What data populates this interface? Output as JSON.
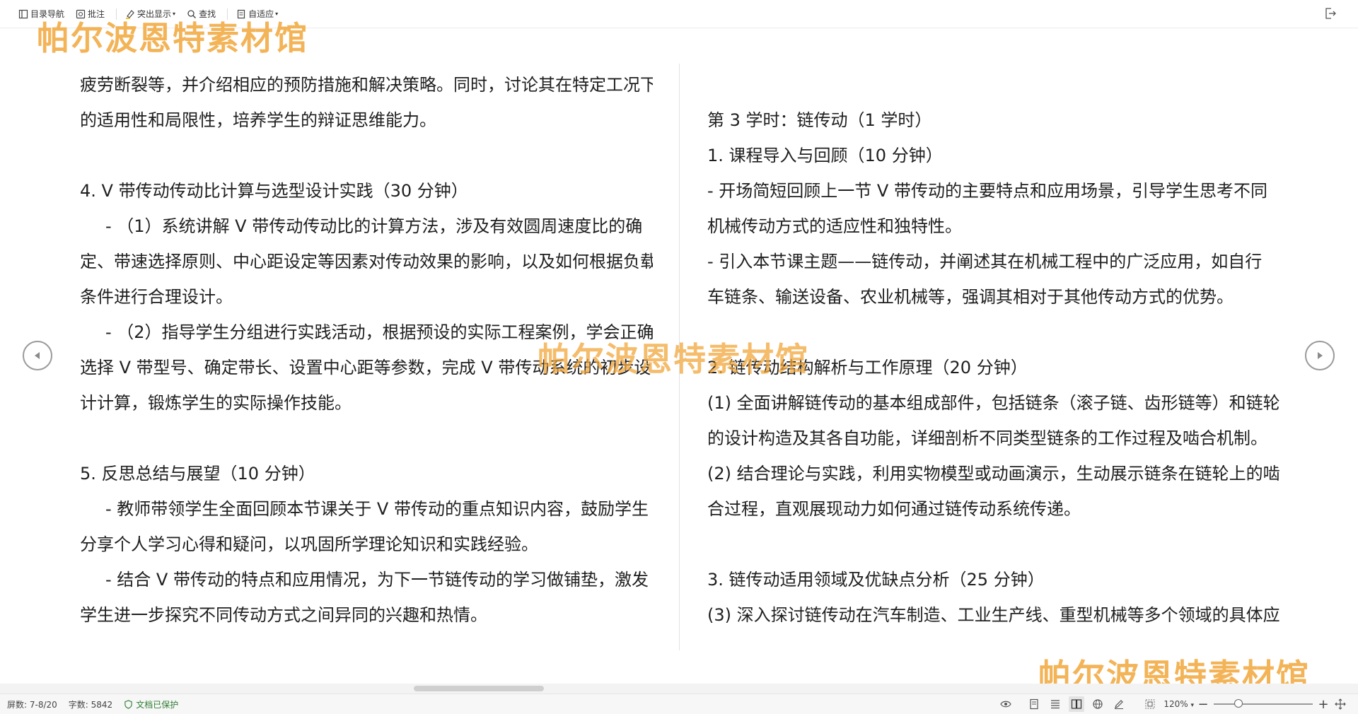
{
  "toolbar": {
    "items": [
      {
        "label": "目录导航",
        "icon": "outline-icon"
      },
      {
        "label": "批注",
        "icon": "comment-icon"
      },
      {
        "label": "突出显示",
        "icon": "highlight-icon"
      },
      {
        "label": "查找",
        "icon": "search-icon"
      },
      {
        "label": "自适应",
        "icon": "fit-page-icon"
      }
    ],
    "exit_icon": "exit-icon"
  },
  "watermark": {
    "text": "帕尔波恩特素材馆"
  },
  "left_page": {
    "lines": [
      "疲劳断裂等，并介绍相应的预防措施和解决策略。同时，讨论其在特定工况下",
      "的适用性和局限性，培养学生的辩证思维能力。",
      "",
      "4. V 带传动传动比计算与选型设计实践（30 分钟）",
      "- （1）系统讲解 V 带传动传动比的计算方法，涉及有效圆周速度比的确",
      "定、带速选择原则、中心距设定等因素对传动效果的影响，以及如何根据负载",
      "条件进行合理设计。",
      "- （2）指导学生分组进行实践活动，根据预设的实际工程案例，学会正确",
      "选择 V 带型号、确定带长、设置中心距等参数，完成 V 带传动系统的初步设",
      "计计算，锻炼学生的实际操作技能。",
      "",
      "5. 反思总结与展望（10 分钟）",
      "- 教师带领学生全面回顾本节课关于 V 带传动的重点知识内容，鼓励学生",
      "分享个人学习心得和疑问，以巩固所学理论知识和实践经验。",
      "- 结合 V 带传动的特点和应用情况，为下一节链传动的学习做铺垫，激发",
      "学生进一步探究不同传动方式之间异同的兴趣和热情。"
    ]
  },
  "right_page": {
    "lines": [
      "",
      "第 3 学时：链传动（1 学时）",
      "1. 课程导入与回顾（10 分钟）",
      "- 开场简短回顾上一节 V 带传动的主要特点和应用场景，引导学生思考不同",
      "机械传动方式的适应性和独特性。",
      "- 引入本节课主题——链传动，并阐述其在机械工程中的广泛应用，如自行",
      "车链条、输送设备、农业机械等，强调其相对于其他传动方式的优势。",
      "",
      "2. 链传动结构解析与工作原理（20 分钟）",
      "(1) 全面讲解链传动的基本组成部件，包括链条（滚子链、齿形链等）和链轮",
      "的设计构造及其各自功能，详细剖析不同类型链条的工作过程及啮合机制。",
      "(2) 结合理论与实践，利用实物模型或动画演示，生动展示链条在链轮上的啮",
      "合过程，直观展现动力如何通过链传动系统传递。",
      "",
      "3. 链传动适用领域及优缺点分析（25 分钟）",
      "(3) 深入探讨链传动在汽车制造、工业生产线、重型机械等多个领域的具体应"
    ]
  },
  "status": {
    "page_info": "屏数: 7-8/20",
    "word_count": "字数: 5842",
    "protect_label": "文档已保护",
    "zoom": "120%",
    "zoom_level_percent": 120
  },
  "colors": {
    "watermark": "#f1a63a",
    "protect_green": "#2e7d32"
  }
}
